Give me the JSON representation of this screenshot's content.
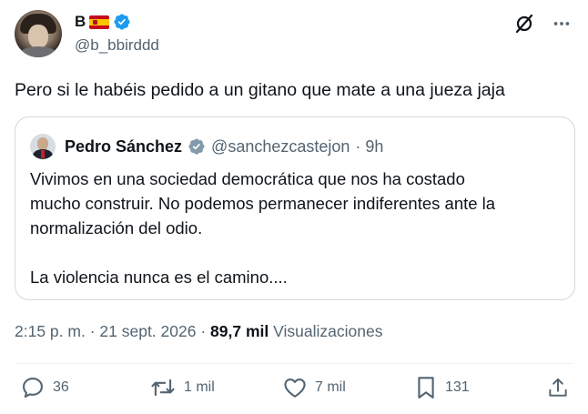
{
  "author": {
    "display_name": "B",
    "handle": "@b_bbirddd",
    "flag_icon": "spain-flag-icon",
    "verified_color": "#1d9bf0"
  },
  "tweet": {
    "text": "Pero si le habéis pedido a un gitano que mate a una jueza jaja"
  },
  "quote": {
    "name": "Pedro Sánchez",
    "handle": "@sanchezcastejon",
    "time": "· 9h",
    "verified_color": "#829aab",
    "lines": [
      "Vivimos en una sociedad democrática que nos ha costado",
      "mucho construir. No podemos permanecer indiferentes ante la",
      "normalización del odio.",
      "La violencia nunca es el camino...."
    ]
  },
  "meta": {
    "time": "2:15 p. m.",
    "date": "21 sept. 2026",
    "views_count": "89,7 mil",
    "views_label": "Visualizaciones",
    "separator": "·"
  },
  "actions": {
    "replies": "36",
    "reposts": "1 mil",
    "likes": "7 mil",
    "bookmarks": "131"
  },
  "colors": {
    "text": "#0f1419",
    "secondary": "#536471",
    "border": "#cfd9de"
  }
}
